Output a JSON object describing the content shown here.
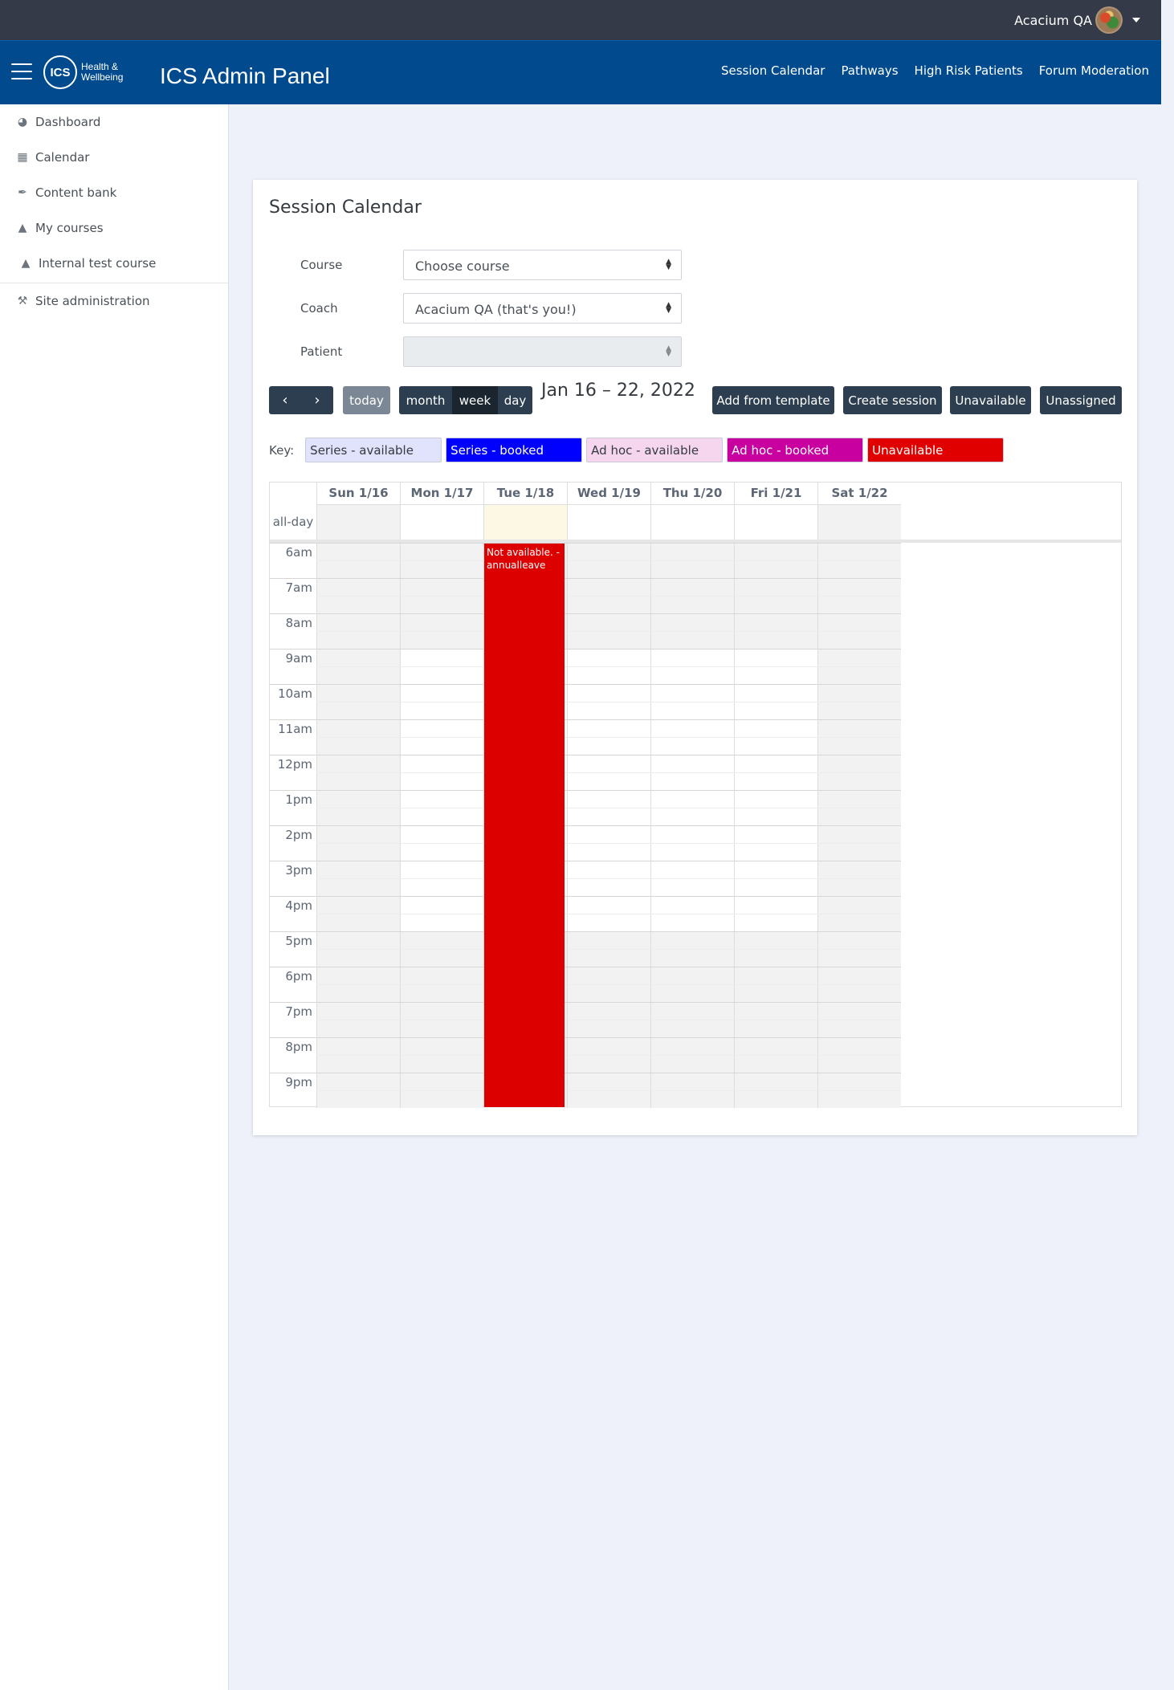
{
  "topbar": {
    "user_name": "Acacium QA"
  },
  "header": {
    "logo_mark": "ICS",
    "logo_line1": "Health &",
    "logo_line2": "Wellbeing",
    "title": "ICS Admin Panel",
    "nav": [
      "Session Calendar",
      "Pathways",
      "High Risk Patients",
      "Forum Moderation"
    ]
  },
  "sidebar": {
    "items": [
      {
        "label": "Dashboard",
        "icon": "dashboard-icon"
      },
      {
        "label": "Calendar",
        "icon": "calendar-icon"
      },
      {
        "label": "Content bank",
        "icon": "brush-icon"
      },
      {
        "label": "My courses",
        "icon": "graduation-cap-icon"
      },
      {
        "label": "Internal test course",
        "icon": "graduation-cap-icon"
      },
      {
        "label": "Site administration",
        "icon": "wrench-icon"
      }
    ]
  },
  "main": {
    "card_title": "Session Calendar",
    "course_label": "Course",
    "course_value": "Choose course",
    "coach_label": "Coach",
    "coach_value": "Acacium QA (that's you!)",
    "patient_label": "Patient",
    "patient_value": "",
    "today_label": "today",
    "view_month": "month",
    "view_week": "week",
    "view_day": "day",
    "range_title": "Jan 16 – 22, 2022",
    "add_template_label": "Add from template",
    "create_session_label": "Create session",
    "unavailable_label": "Unavailable",
    "unassigned_label": "Unassigned",
    "key_label": "Key:",
    "key_items": [
      {
        "label": "Series - available",
        "bg": "#e1e2fc",
        "fg": "#343a40"
      },
      {
        "label": "Series - booked",
        "bg": "#0000ff",
        "fg": "#ffffff"
      },
      {
        "label": "Ad hoc - available",
        "bg": "#f6d6ee",
        "fg": "#343a40"
      },
      {
        "label": "Ad hoc - booked",
        "bg": "#c800a0",
        "fg": "#ffffff"
      },
      {
        "label": "Unavailable",
        "bg": "#e00000",
        "fg": "#ffffff"
      }
    ]
  },
  "calendar": {
    "allday_label": "all-day",
    "days": [
      "Sun 1/16",
      "Mon 1/17",
      "Tue 1/18",
      "Wed 1/19",
      "Thu 1/20",
      "Fri 1/21",
      "Sat 1/22"
    ],
    "hours": [
      "6am",
      "7am",
      "8am",
      "9am",
      "10am",
      "11am",
      "12pm",
      "1pm",
      "2pm",
      "3pm",
      "4pm",
      "5pm",
      "6pm",
      "7pm",
      "8pm",
      "9pm"
    ],
    "today_index": 2,
    "business_hours": {
      "start": "9am",
      "end": "5pm",
      "weekdays": [
        1,
        2,
        3,
        4,
        5
      ]
    },
    "events": [
      {
        "day_index": 2,
        "start": "6am",
        "end": "10pm",
        "title": "Not available. - annualleave",
        "color": "#dd0000"
      }
    ]
  },
  "colors": {
    "topbar": "#343a48",
    "header": "#004a8d",
    "button": "#2c3e50",
    "unavailable": "#dd0000",
    "today_allday": "#fcf8e3",
    "non_business": "#f2f2f2"
  }
}
